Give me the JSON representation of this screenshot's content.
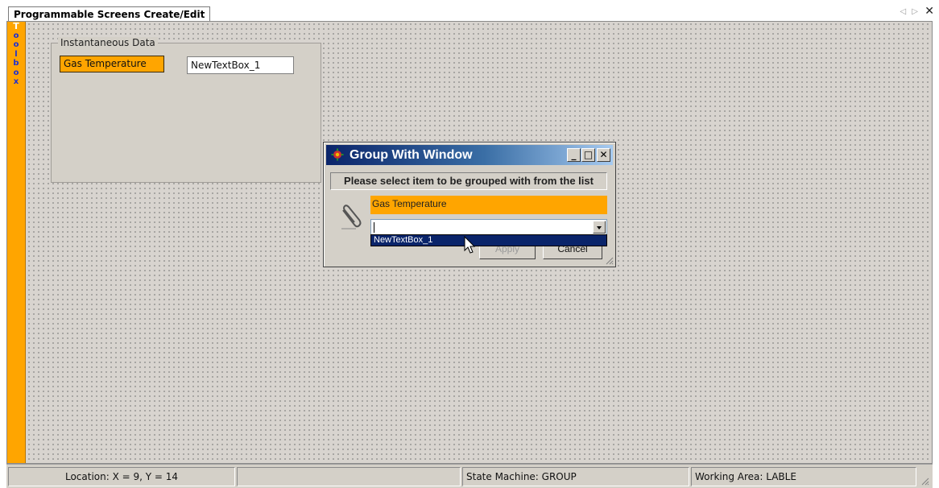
{
  "tab": {
    "title": "Programmable Screens Create/Edit",
    "nav_glyph": "◁ ▷",
    "close_glyph": "✕"
  },
  "toolbox": {
    "letters": [
      "T",
      "o",
      "o",
      "l",
      "b",
      "o",
      "x"
    ],
    "color": "#FFA500"
  },
  "groupbox": {
    "legend": "Instantaneous Data",
    "label": "Gas Temperature",
    "textbox_value": "NewTextBox_1"
  },
  "dialog": {
    "title": "Group With Window",
    "minimize": "_",
    "maximize": "□",
    "close": "✕",
    "prompt": "Please select item to be grouped with from the list",
    "selected_item": "Gas Temperature",
    "combo_value": "",
    "dropdown_options": [
      "NewTextBox_1"
    ],
    "apply_label": "Apply",
    "cancel_label": "Cancel"
  },
  "statusbar": {
    "location": "Location: X = 9, Y = 14",
    "blank": "",
    "state_machine": "State Machine: GROUP",
    "working_area": "Working Area: LABLE"
  },
  "colors": {
    "accent_orange": "#FFA500",
    "titlebar_start": "#0A246A",
    "titlebar_end": "#A6CAF0",
    "selection": "#0A246A"
  }
}
